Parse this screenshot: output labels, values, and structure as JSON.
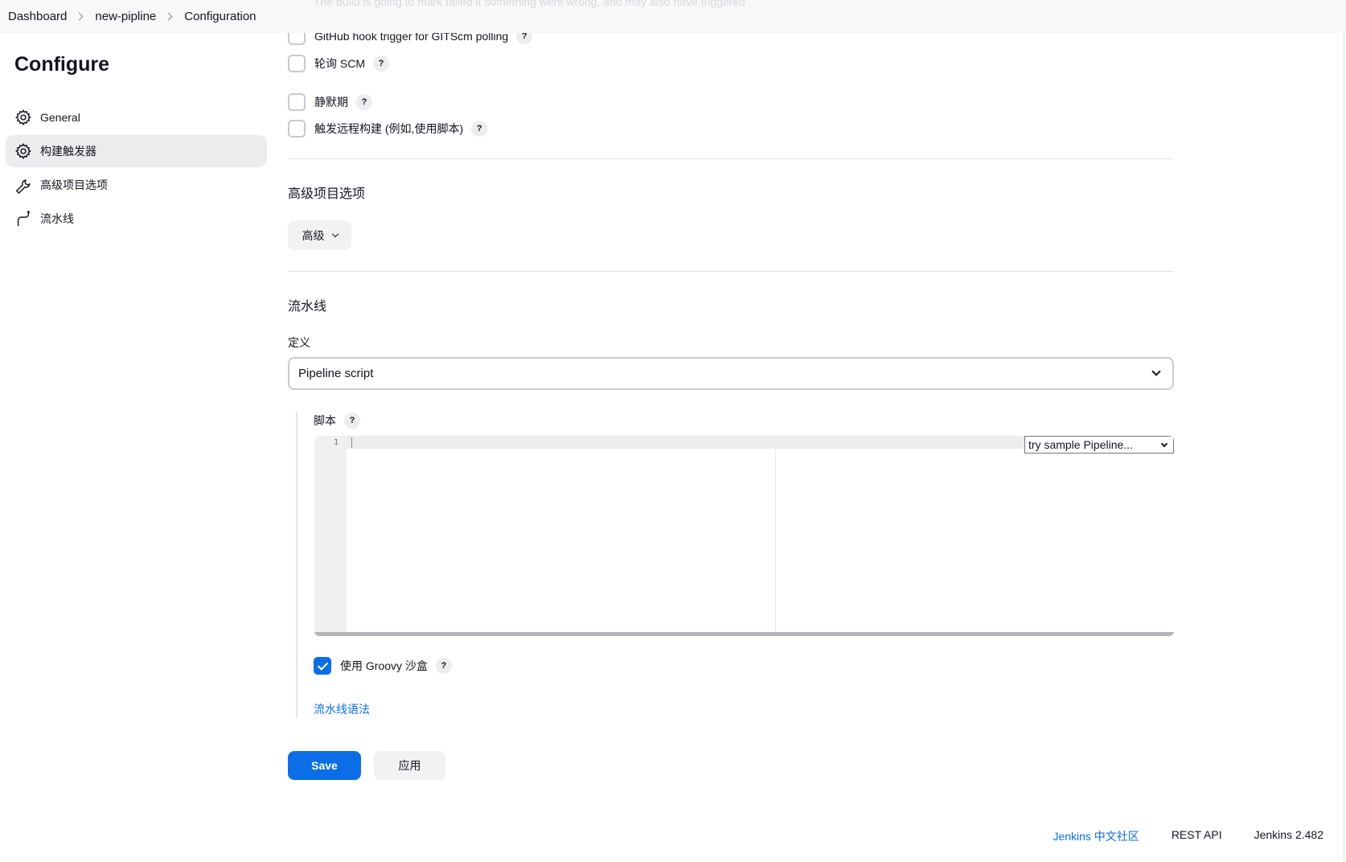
{
  "breadcrumb": {
    "items": [
      "Dashboard",
      "new-pipline",
      "Configuration"
    ],
    "ghost_text": "The build is going to mark failed if something went wrong, and may also have triggered"
  },
  "sidebar": {
    "title": "Configure",
    "items": [
      {
        "label": "General",
        "icon": "gear-icon",
        "active": false
      },
      {
        "label": "构建触发器",
        "icon": "gear-icon",
        "active": true
      },
      {
        "label": "高级项目选项",
        "icon": "wrench-icon",
        "active": false
      },
      {
        "label": "流水线",
        "icon": "pipeline-icon",
        "active": false
      }
    ]
  },
  "triggers": {
    "github_hook": {
      "label": "GitHub hook trigger for GITScm polling",
      "checked": false
    },
    "poll_scm": {
      "label": "轮询 SCM",
      "checked": false
    },
    "quiet_period": {
      "label": "静默期",
      "checked": false
    },
    "remote_build": {
      "label": "触发远程构建 (例如,使用脚本)",
      "checked": false
    },
    "help_glyph": "?"
  },
  "advanced": {
    "section_title": "高级项目选项",
    "button_label": "高级"
  },
  "pipeline": {
    "section_title": "流水线",
    "definition_label": "定义",
    "definition_value": "Pipeline script",
    "script_label": "脚本",
    "line_number": "1",
    "sample_select": "try sample Pipeline...",
    "groovy_sandbox": {
      "label": "使用 Groovy 沙盒",
      "checked": true
    },
    "syntax_link": "流水线语法"
  },
  "actions": {
    "save_label": "Save",
    "apply_label": "应用"
  },
  "footer": {
    "community_link": "Jenkins 中文社区",
    "rest_api": "REST API",
    "version": "Jenkins 2.482"
  },
  "colors": {
    "accent": "#0b6ee6",
    "active_nav": "#ececef",
    "border": "#c9c9d1"
  }
}
